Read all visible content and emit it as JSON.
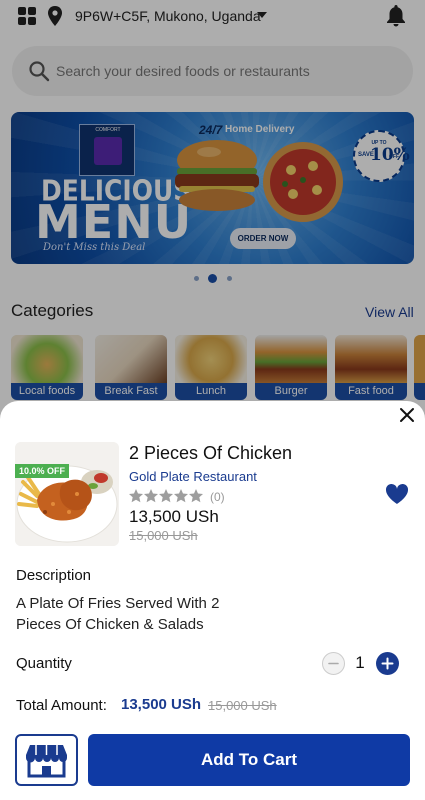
{
  "header": {
    "location": "9P6W+C5F, Mukono, Uganda",
    "icons": [
      "grid-menu-icon",
      "location-pin-icon",
      "chevron-down-icon",
      "bell-icon"
    ]
  },
  "search": {
    "placeholder": "Search your desired foods or restaurants"
  },
  "banner": {
    "logo_text": "COMFORT",
    "headline_1": "DELICIOUS",
    "headline_2": "MENU",
    "tagline": "Don't Miss this Deal",
    "service_prefix": "24/7",
    "service_label": "Home Delivery",
    "button_label": "ORDER NOW",
    "badge_upto": "UP TO",
    "badge_save": "SAVE",
    "badge_percent": "10%",
    "badge_off": "OFF",
    "slide_count": 3,
    "active_slide": 2
  },
  "categories": {
    "title": "Categories",
    "view_all": "View All",
    "items": [
      {
        "label": "Local foods"
      },
      {
        "label": "Break Fast"
      },
      {
        "label": "Lunch"
      },
      {
        "label": "Burger"
      },
      {
        "label": "Fast food"
      }
    ]
  },
  "product": {
    "discount_badge": "10.0% OFF",
    "name": "2 Pieces Of Chicken",
    "restaurant": "Gold Plate Restaurant",
    "rating": 0,
    "rating_count": "(0)",
    "price": "13,500 USh",
    "old_price": "15,000 USh",
    "favorite": true,
    "description_title": "Description",
    "description": "A Plate Of Fries Served With 2 Pieces Of Chicken & Salads",
    "quantity_label": "Quantity",
    "quantity": "1",
    "total_label": "Total Amount:",
    "total_value": "13,500 USh",
    "total_old": "15,000 USh",
    "add_to_cart": "Add To Cart"
  },
  "colors": {
    "accent": "#1a3b8f",
    "button": "#0f3aa5",
    "discount": "#4caf50",
    "category_label": "#1d4fa6"
  }
}
